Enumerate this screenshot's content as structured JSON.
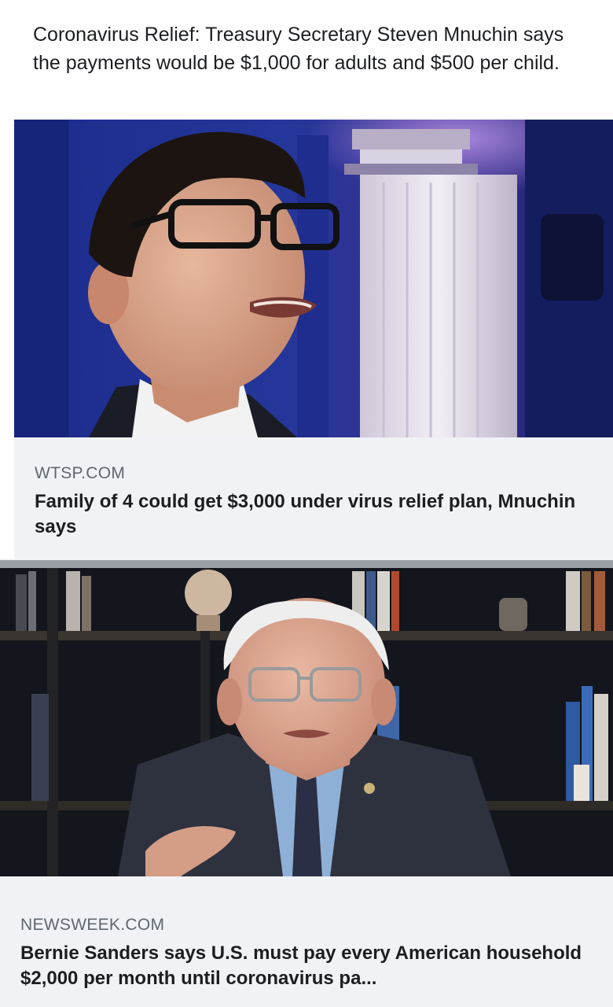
{
  "post1": {
    "caption": "Coronavirus Relief: Treasury Secretary Steven Mnuchin says the payments would be $1,000 for adults and $500 per child.",
    "link": {
      "domain": "WTSP.COM",
      "headline": "Family of 4 could get $3,000 under virus relief plan, Mnuchin says"
    }
  },
  "post2": {
    "link": {
      "domain": "NEWSWEEK.COM",
      "headline": "Bernie Sanders says U.S. must pay every American household $2,000 per month until coronavirus pa..."
    }
  },
  "colors": {
    "post_background": "#ffffff",
    "link_footer": "#f0f2f5",
    "domain_text": "#606770",
    "headline_text": "#1c1e21",
    "divider": "#9aa0a6"
  }
}
